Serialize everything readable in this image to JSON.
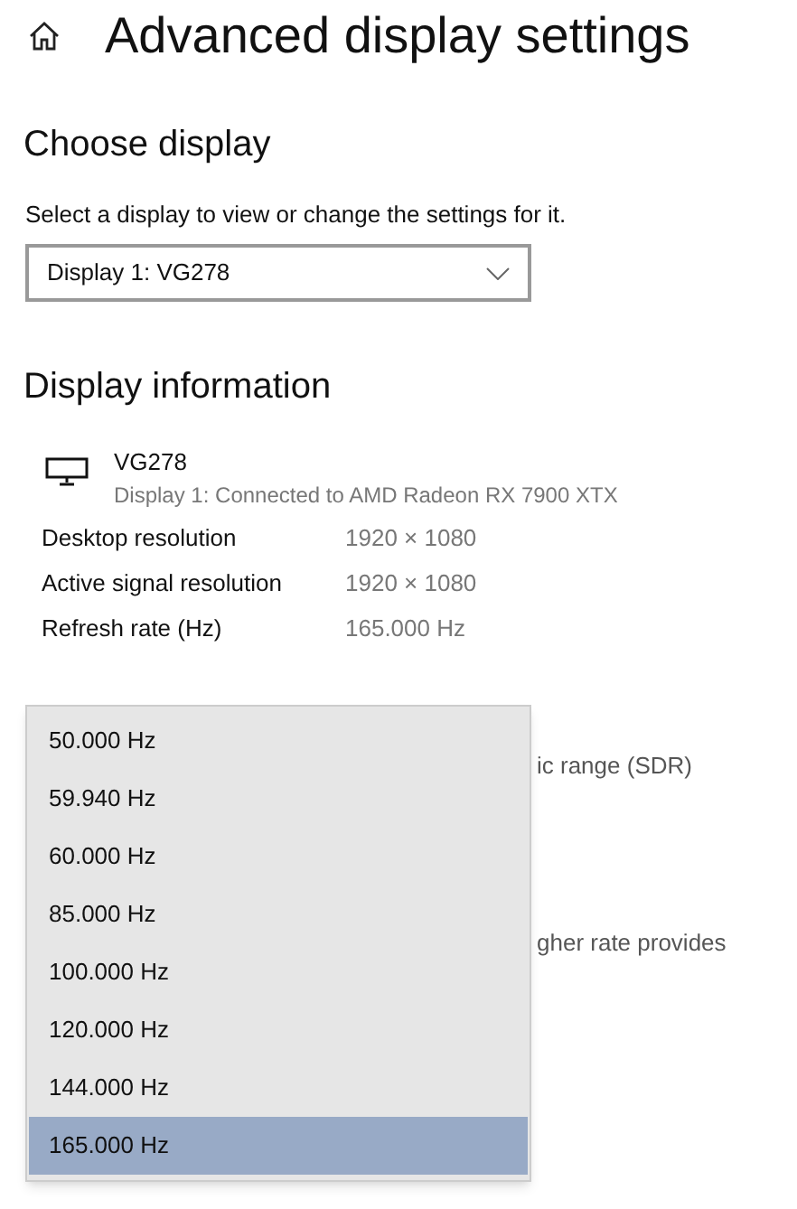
{
  "page": {
    "title": "Advanced display settings"
  },
  "choose_display": {
    "heading": "Choose display",
    "description": "Select a display to view or change the settings for it.",
    "dropdown_value": "Display 1: VG278"
  },
  "display_information": {
    "heading": "Display information",
    "monitor_name": "VG278",
    "monitor_connection": "Display 1: Connected to AMD Radeon RX 7900 XTX",
    "rows": [
      {
        "label": "Desktop resolution",
        "value": "1920 × 1080"
      },
      {
        "label": "Active signal resolution",
        "value": "1920 × 1080"
      },
      {
        "label": "Refresh rate (Hz)",
        "value": "165.000 Hz"
      }
    ],
    "partial_texts": [
      "ic range (SDR)",
      "gher rate provides"
    ]
  },
  "refresh_rate_menu": {
    "options": [
      {
        "label": "50.000 Hz",
        "selected": false
      },
      {
        "label": "59.940 Hz",
        "selected": false
      },
      {
        "label": "60.000 Hz",
        "selected": false
      },
      {
        "label": "85.000 Hz",
        "selected": false
      },
      {
        "label": "100.000 Hz",
        "selected": false
      },
      {
        "label": "120.000 Hz",
        "selected": false
      },
      {
        "label": "144.000 Hz",
        "selected": false
      },
      {
        "label": "165.000 Hz",
        "selected": true
      }
    ]
  }
}
